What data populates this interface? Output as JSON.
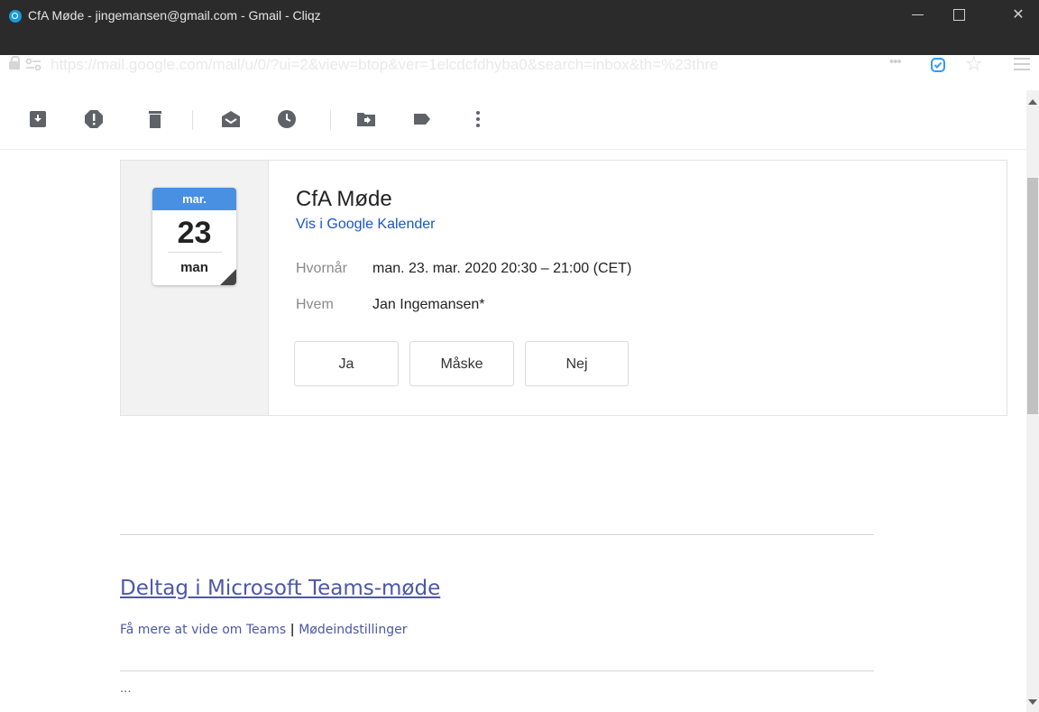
{
  "window": {
    "title": "CfA Møde - jingemansen@gmail.com - Gmail - Cliqz",
    "minimize_glyph": "—",
    "close_glyph": "✕"
  },
  "address_bar": {
    "url": "https://mail.google.com/mail/u/0/?ui=2&view=btop&ver=1elcdcfdhyba0&search=inbox&th=%23thre",
    "page_actions": "•••"
  },
  "toolbar": {
    "icons": [
      "archive-icon",
      "report-spam-icon",
      "delete-icon",
      "mark-unread-icon",
      "snooze-icon",
      "move-to-icon",
      "label-icon",
      "more-icon"
    ]
  },
  "event": {
    "calendar": {
      "month": "mar.",
      "day": "23",
      "weekday": "man"
    },
    "title": "CfA Møde",
    "calendar_link": "Vis i Google Kalender",
    "when_label": "Hvornår",
    "when_value": "man. 23. mar. 2020 20:30 – 21:00 (CET)",
    "who_label": "Hvem",
    "who_value": "Jan Ingemansen*",
    "rsvp": {
      "yes": "Ja",
      "maybe": "Måske",
      "no": "Nej"
    }
  },
  "teams": {
    "join_link": "Deltag i Microsoft Teams-møde",
    "learn_more": "Få mere at vide om Teams",
    "separator": "|",
    "settings": "Mødeindstillinger",
    "ellipsis": "..."
  },
  "colors": {
    "titlebar_bg": "#2b2b2b",
    "accent_blue": "#4a90e2",
    "link_blue": "#1a56c8",
    "teams_purple": "#4c57a8",
    "extension_blue": "#2f9bff"
  }
}
